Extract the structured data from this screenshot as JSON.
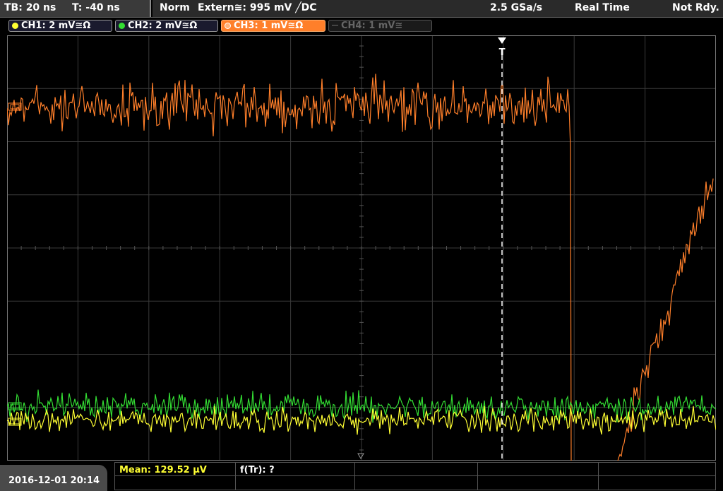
{
  "status_bar": {
    "timebase": "TB: 20 ns",
    "trigger_offset": "T: -40 ns",
    "trigger_mode": "Norm",
    "trigger_source": "Extern≅: 995 mV ╱DC",
    "sample_rate": "2.5 GSa/s",
    "acquisition_mode": "Real Time",
    "state": "Not Rdy."
  },
  "channels": [
    {
      "label": "CH1: 2 mV≅Ω",
      "color": "#ffff33",
      "active": true
    },
    {
      "label": "CH2: 2 mV≅Ω",
      "color": "#33dd33",
      "active": true
    },
    {
      "label": "CH3: 1 mV≅Ω",
      "color": "#ff7f2a",
      "active": true,
      "selected": true
    },
    {
      "label": "CH4: 1 mV≅",
      "color": "#555555",
      "active": false
    }
  ],
  "trigger_marker": "T",
  "measurements": {
    "mean": "Mean: 129.52 µV",
    "rise_time": "f(Tr): ?"
  },
  "datetime": "2016-12-01 20:14",
  "colors": {
    "ch1": "#ffff33",
    "ch2": "#33dd33",
    "ch3": "#ff7f2a",
    "grid": "#3a3a3a",
    "trigger_line": "#ffffff"
  }
}
